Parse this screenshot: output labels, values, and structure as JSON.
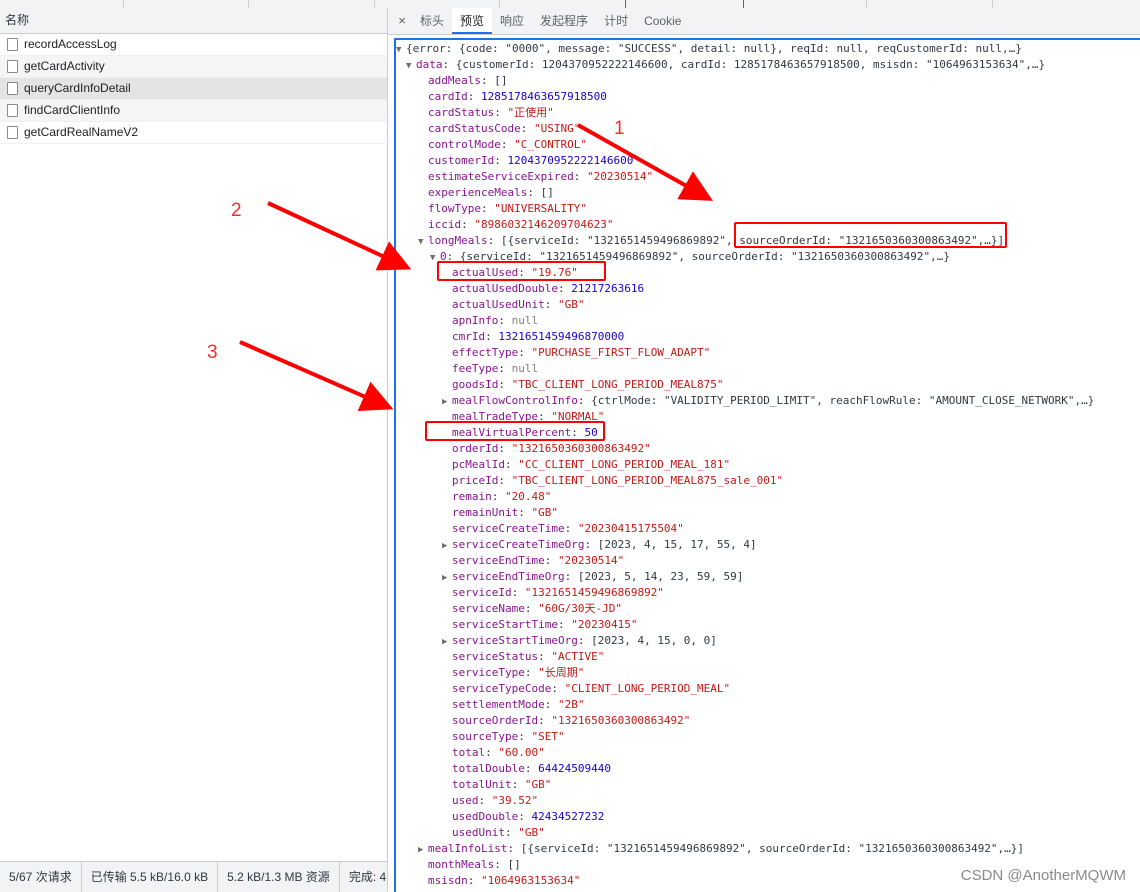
{
  "left": {
    "column_header": "名称",
    "requests": [
      "recordAccessLog",
      "getCardActivity",
      "queryCardInfoDetail",
      "findCardClientInfo",
      "getCardRealNameV2"
    ],
    "status": [
      "5/67 次请求",
      "已传输 5.5 kB/16.0 kB",
      "5.2 kB/1.3 MB 资源",
      "完成: 4"
    ]
  },
  "tabs": {
    "close_glyph": "×",
    "items": [
      "标头",
      "预览",
      "响应",
      "发起程序",
      "计时",
      "Cookie"
    ],
    "active": "预览"
  },
  "preview": {
    "lines": [
      {
        "d": 0,
        "t": "▼",
        "k": "",
        "v": "{error: {code: \"0000\", message: \"SUCCESS\", detail: null}, reqId: null, reqCustomerId: null,…}",
        "c": "sum"
      },
      {
        "d": 1,
        "t": "▼",
        "k": "data",
        "v": "{customerId: 1204370952222146600, cardId: 1285178463657918500, msisdn: \"1064963153634\",…}",
        "c": "sum"
      },
      {
        "d": 2,
        "t": "",
        "k": "addMeals",
        "v": "[]",
        "c": "sum"
      },
      {
        "d": 2,
        "t": "",
        "k": "cardId",
        "v": "1285178463657918500",
        "c": "num"
      },
      {
        "d": 2,
        "t": "",
        "k": "cardStatus",
        "v": "\"正使用\"",
        "c": "str"
      },
      {
        "d": 2,
        "t": "",
        "k": "cardStatusCode",
        "v": "\"USING\"",
        "c": "str"
      },
      {
        "d": 2,
        "t": "",
        "k": "controlMode",
        "v": "\"C_CONTROL\"",
        "c": "str"
      },
      {
        "d": 2,
        "t": "",
        "k": "customerId",
        "v": "1204370952222146600",
        "c": "num"
      },
      {
        "d": 2,
        "t": "",
        "k": "estimateServiceExpired",
        "v": "\"20230514\"",
        "c": "str"
      },
      {
        "d": 2,
        "t": "",
        "k": "experienceMeals",
        "v": "[]",
        "c": "sum"
      },
      {
        "d": 2,
        "t": "",
        "k": "flowType",
        "v": "\"UNIVERSALITY\"",
        "c": "str"
      },
      {
        "d": 2,
        "t": "",
        "k": "iccid",
        "v": "\"898603214620970462​3\"",
        "c": "str"
      },
      {
        "d": 2,
        "t": "▼",
        "k": "longMeals",
        "v": "[{serviceId: \"1321651459496869892\", sourceOrderId: \"1321650360300863492\",…}]",
        "c": "sum"
      },
      {
        "d": 3,
        "t": "▼",
        "k": "0",
        "v": "{serviceId: \"1321651459496869892\", sourceOrderId: \"1321650360300863492\",…}",
        "c": "sum"
      },
      {
        "d": 4,
        "t": "",
        "k": "actualUsed",
        "v": "\"19.76\"",
        "c": "str"
      },
      {
        "d": 4,
        "t": "",
        "k": "actualUsedDouble",
        "v": "21217263616",
        "c": "num"
      },
      {
        "d": 4,
        "t": "",
        "k": "actualUsedUnit",
        "v": "\"GB\"",
        "c": "str"
      },
      {
        "d": 4,
        "t": "",
        "k": "apnInfo",
        "v": "null",
        "c": "nul"
      },
      {
        "d": 4,
        "t": "",
        "k": "cmrId",
        "v": "1321651459496870000",
        "c": "num"
      },
      {
        "d": 4,
        "t": "",
        "k": "effectType",
        "v": "\"PURCHASE_FIRST_FLOW_ADAPT\"",
        "c": "str"
      },
      {
        "d": 4,
        "t": "",
        "k": "feeType",
        "v": "null",
        "c": "nul"
      },
      {
        "d": 4,
        "t": "",
        "k": "goodsId",
        "v": "\"TBC_CLIENT_LONG_PERIOD_MEAL875\"",
        "c": "str"
      },
      {
        "d": 4,
        "t": "▶",
        "k": "mealFlowControlInfo",
        "v": "{ctrlMode: \"VALIDITY_PERIOD_LIMIT\", reachFlowRule: \"AMOUNT_CLOSE_NETWORK\",…}",
        "c": "sum"
      },
      {
        "d": 4,
        "t": "",
        "k": "mealTradeType",
        "v": "\"NORMAL\"",
        "c": "str"
      },
      {
        "d": 4,
        "t": "",
        "k": "mealVirtualPercent",
        "v": "50",
        "c": "num"
      },
      {
        "d": 4,
        "t": "",
        "k": "orderId",
        "v": "\"1321650360300863492\"",
        "c": "str"
      },
      {
        "d": 4,
        "t": "",
        "k": "pcMealId",
        "v": "\"CC_CLIENT_LONG_PERIOD_MEAL_181\"",
        "c": "str"
      },
      {
        "d": 4,
        "t": "",
        "k": "priceId",
        "v": "\"TBC_CLIENT_LONG_PERIOD_MEAL875_sale_001\"",
        "c": "str"
      },
      {
        "d": 4,
        "t": "",
        "k": "remain",
        "v": "\"20.48\"",
        "c": "str"
      },
      {
        "d": 4,
        "t": "",
        "k": "remainUnit",
        "v": "\"GB\"",
        "c": "str"
      },
      {
        "d": 4,
        "t": "",
        "k": "serviceCreateTime",
        "v": "\"20230415175504\"",
        "c": "str"
      },
      {
        "d": 4,
        "t": "▶",
        "k": "serviceCreateTimeOrg",
        "v": "[2023, 4, 15, 17, 55, 4]",
        "c": "sum"
      },
      {
        "d": 4,
        "t": "",
        "k": "serviceEndTime",
        "v": "\"20230514\"",
        "c": "str"
      },
      {
        "d": 4,
        "t": "▶",
        "k": "serviceEndTimeOrg",
        "v": "[2023, 5, 14, 23, 59, 59]",
        "c": "sum"
      },
      {
        "d": 4,
        "t": "",
        "k": "serviceId",
        "v": "\"1321651459496869892\"",
        "c": "str"
      },
      {
        "d": 4,
        "t": "",
        "k": "serviceName",
        "v": "\"60G/30天-JD\"",
        "c": "str"
      },
      {
        "d": 4,
        "t": "",
        "k": "serviceStartTime",
        "v": "\"20230415\"",
        "c": "str"
      },
      {
        "d": 4,
        "t": "▶",
        "k": "serviceStartTimeOrg",
        "v": "[2023, 4, 15, 0, 0]",
        "c": "sum"
      },
      {
        "d": 4,
        "t": "",
        "k": "serviceStatus",
        "v": "\"ACTIVE\"",
        "c": "str"
      },
      {
        "d": 4,
        "t": "",
        "k": "serviceType",
        "v": "\"长周期\"",
        "c": "str"
      },
      {
        "d": 4,
        "t": "",
        "k": "serviceTypeCode",
        "v": "\"CLIENT_LONG_PERIOD_MEAL\"",
        "c": "str"
      },
      {
        "d": 4,
        "t": "",
        "k": "settlementMode",
        "v": "\"2B\"",
        "c": "str"
      },
      {
        "d": 4,
        "t": "",
        "k": "sourceOrderId",
        "v": "\"1321650360300863492\"",
        "c": "str"
      },
      {
        "d": 4,
        "t": "",
        "k": "sourceType",
        "v": "\"SET\"",
        "c": "str"
      },
      {
        "d": 4,
        "t": "",
        "k": "total",
        "v": "\"60.00\"",
        "c": "str"
      },
      {
        "d": 4,
        "t": "",
        "k": "totalDouble",
        "v": "64424509440",
        "c": "num"
      },
      {
        "d": 4,
        "t": "",
        "k": "totalUnit",
        "v": "\"GB\"",
        "c": "str"
      },
      {
        "d": 4,
        "t": "",
        "k": "used",
        "v": "\"39.52\"",
        "c": "str"
      },
      {
        "d": 4,
        "t": "",
        "k": "usedDouble",
        "v": "42434527232",
        "c": "num"
      },
      {
        "d": 4,
        "t": "",
        "k": "usedUnit",
        "v": "\"GB\"",
        "c": "str"
      },
      {
        "d": 2,
        "t": "▶",
        "k": "mealInfoList",
        "v": "[{serviceId: \"1321651459496869892\", sourceOrderId: \"1321650360300863492\",…}]",
        "c": "sum"
      },
      {
        "d": 2,
        "t": "",
        "k": "monthMeals",
        "v": "[]",
        "c": "sum"
      },
      {
        "d": 2,
        "t": "",
        "k": "msisdn",
        "v": "\"1064963153634\"",
        "c": "str"
      }
    ]
  },
  "annotations": {
    "labels": [
      "1",
      "2",
      "3"
    ],
    "color": "#ff0000"
  },
  "watermark": "CSDN @AnotherMQWM",
  "colors": {
    "key": "#881391",
    "string": "#c41a16",
    "number": "#1c00cf",
    "accent": "#1a73e8"
  }
}
